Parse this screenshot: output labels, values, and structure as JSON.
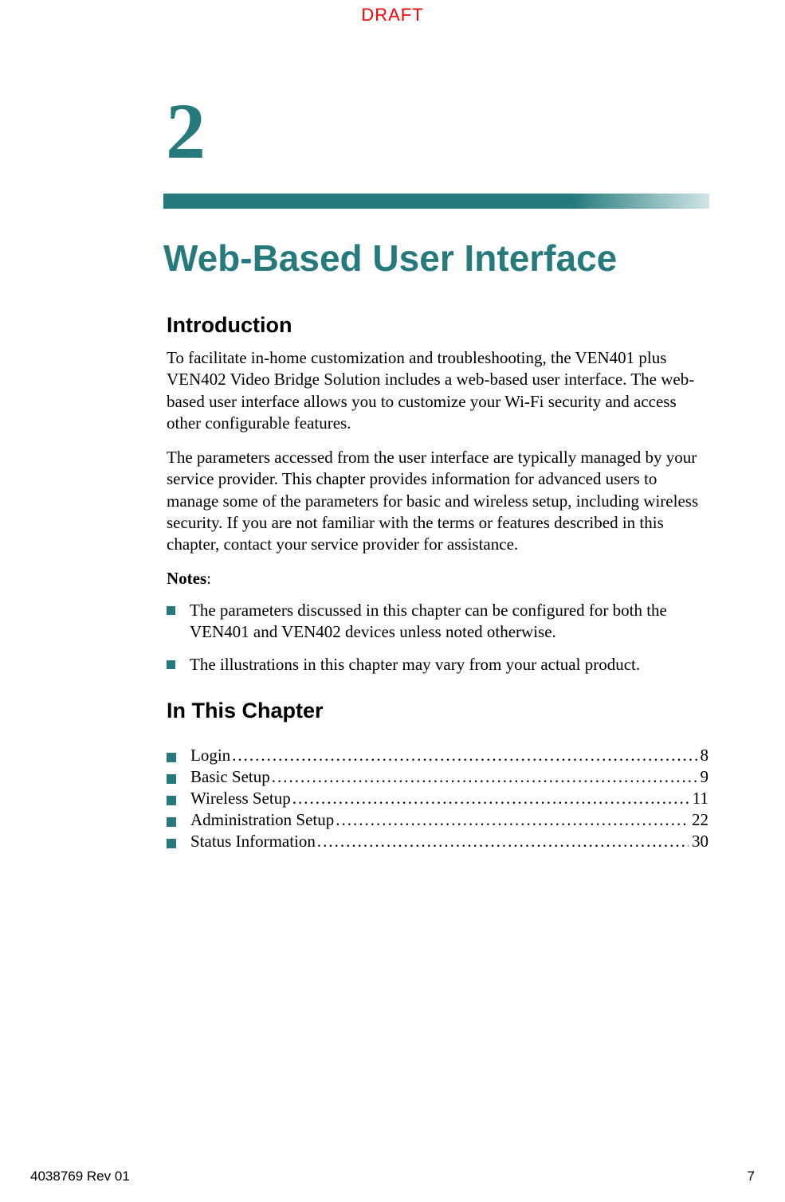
{
  "draft": "DRAFT",
  "chapter_number": "2",
  "chapter_title": "Web-Based User Interface",
  "intro_heading": "Introduction",
  "intro_p1": "To facilitate in-home customization and troubleshooting, the VEN401 plus VEN402 Video Bridge Solution includes a web-based user interface. The web-based user interface allows you to customize your Wi-Fi security and access other configurable features.",
  "intro_p2": "The parameters accessed from the user interface are typically managed by your service provider. This chapter provides information for advanced users to manage some of the parameters for basic and wireless setup, including wireless security. If you are not familiar with the terms or features described in this chapter, contact your service provider for assistance.",
  "notes_label": "Notes",
  "notes_colon": ":",
  "notes": {
    "0": "The parameters discussed in this chapter can be configured for both the VEN401 and VEN402 devices unless noted otherwise.",
    "1": "The illustrations in this chapter may vary from your actual product."
  },
  "toc_heading": "In This Chapter",
  "toc": {
    "0": {
      "label": "Login",
      "page": "8"
    },
    "1": {
      "label": "Basic Setup",
      "page": "9"
    },
    "2": {
      "label": "Wireless Setup",
      "page": "11"
    },
    "3": {
      "label": "Administration Setup",
      "page": "22"
    },
    "4": {
      "label": "Status Information",
      "page": "30"
    }
  },
  "footer": {
    "left": "4038769 Rev 01",
    "right": "7"
  }
}
